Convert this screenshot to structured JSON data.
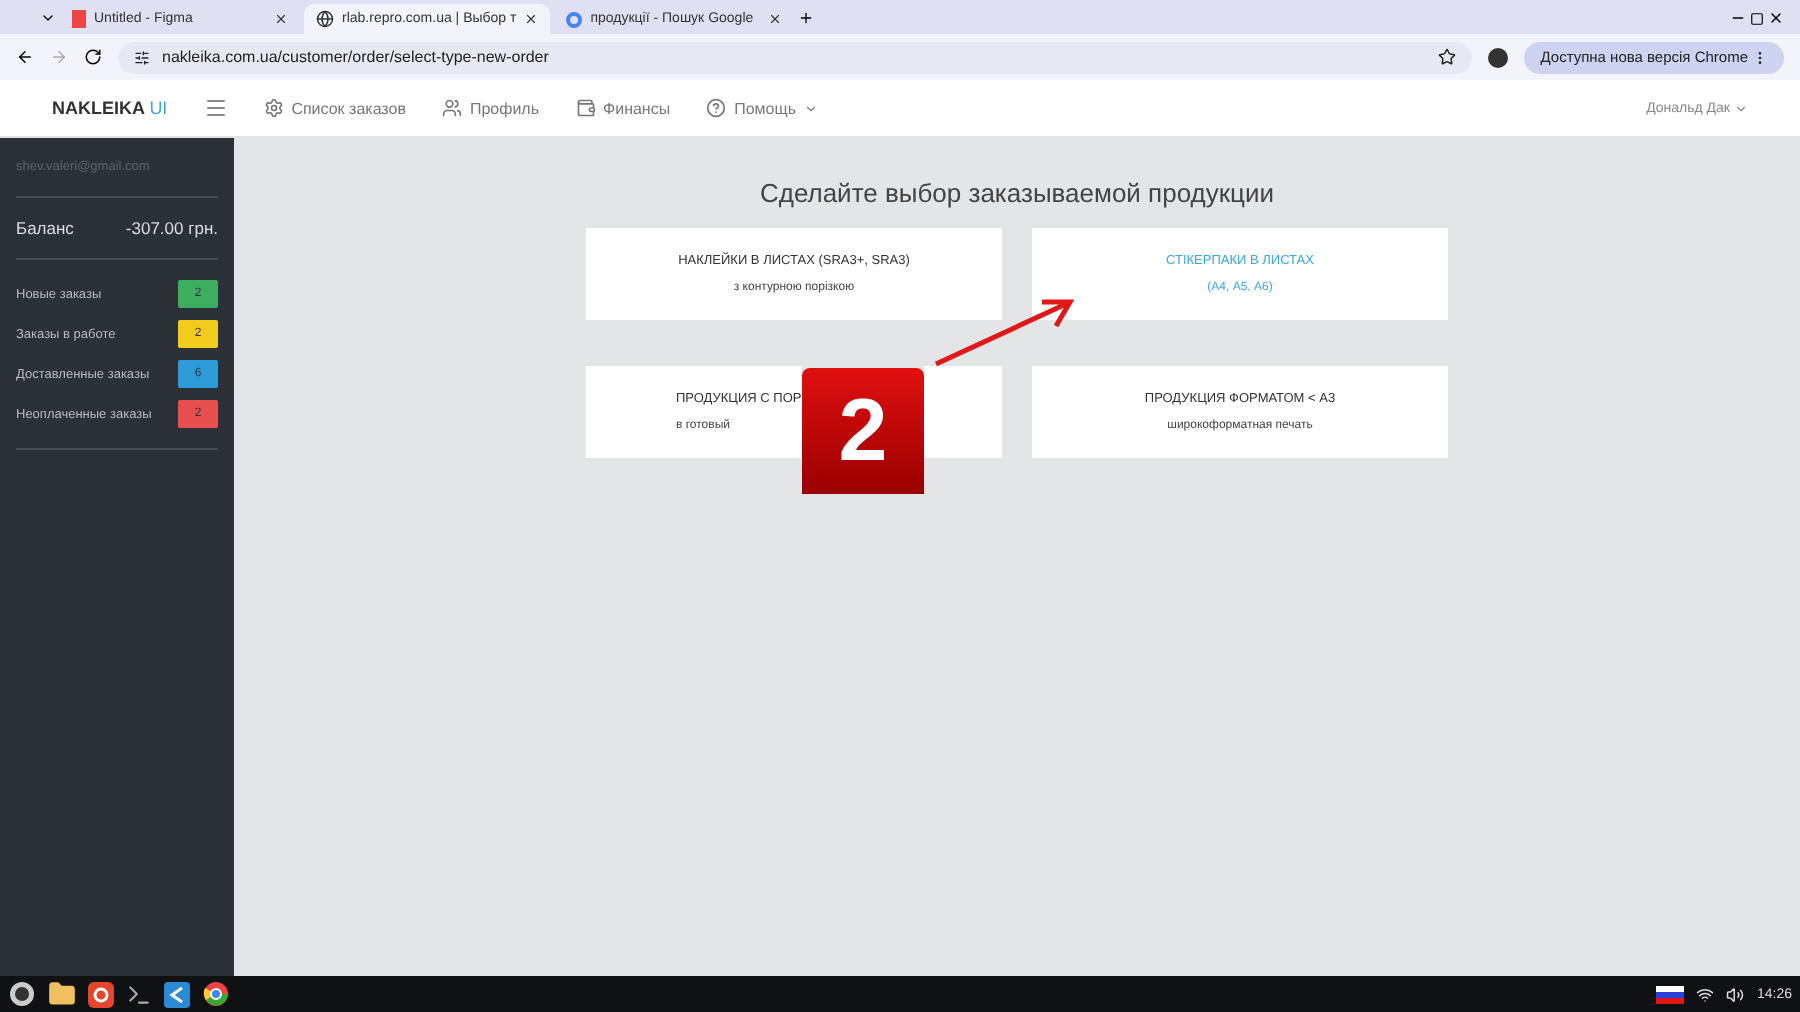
{
  "browser": {
    "tabs": [
      {
        "title": "Untitled - Figma",
        "selected": false
      },
      {
        "title": "rlab.repro.com.ua | Выбор т",
        "selected": true
      },
      {
        "title": "продукції - Пошук Google",
        "selected": false
      }
    ],
    "url": "nakleika.com.ua/customer/order/select-type-new-order",
    "update_button": "Доступна нова версія Chrome"
  },
  "navbar": {
    "logo": "NAKLEIKA",
    "logo_suffix": "UI",
    "items": [
      {
        "label": "Список заказов",
        "dropdown": false
      },
      {
        "label": "Профиль",
        "dropdown": false
      },
      {
        "label": "Финансы",
        "dropdown": false
      },
      {
        "label": "Помощь",
        "dropdown": true
      }
    ],
    "user": "Дональд Дак"
  },
  "sidebar": {
    "email": "shev.valeri@gmail.com",
    "balance_label": "Баланс",
    "balance": "-307.00 грн.",
    "stats": [
      {
        "label": "Новые заказы",
        "count": "2",
        "color": "#3dae5f"
      },
      {
        "label": "Заказы в работе",
        "count": "2",
        "color": "#f2cc1d"
      },
      {
        "label": "Доставленные заказы",
        "count": "6",
        "color": "#2f9ad8"
      },
      {
        "label": "Неоплаченные заказы",
        "count": "2",
        "color": "#e85050"
      }
    ]
  },
  "main": {
    "title": "Сделайте выбор заказываемой продукции",
    "cards": [
      {
        "title": "НАКЛЕЙКИ В ЛИСТАХ (SRA3+, SRA3)",
        "subtitle": "з контурною порізкою",
        "highlighted": false,
        "covered": false
      },
      {
        "title": "СТІКЕРПАКИ В ЛИСТАХ",
        "subtitle": "(А4, А5, А6)",
        "highlighted": true,
        "covered": false
      },
      {
        "title": "ПРОДУКЦИЯ С ПОР",
        "subtitle": "в готовый",
        "highlighted": false,
        "covered": true
      },
      {
        "title": "ПРОДУКЦИЯ ФОРМАТОМ < А3",
        "subtitle": "широкоформатная печать",
        "highlighted": false,
        "covered": false
      }
    ]
  },
  "annotation": {
    "step": "2"
  },
  "taskbar": {
    "time": "14:26"
  }
}
